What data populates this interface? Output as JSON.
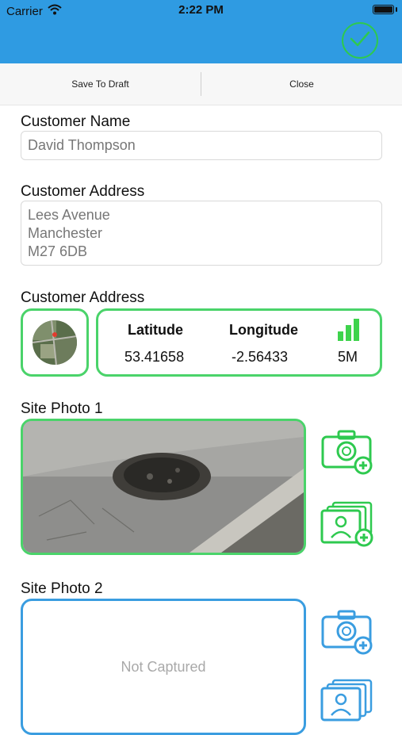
{
  "status_bar": {
    "carrier": "Carrier",
    "time": "2:22 PM"
  },
  "toolbar": {
    "save_draft_label": "Save To Draft",
    "close_label": "Close"
  },
  "customer_name": {
    "label": "Customer Name",
    "value": "David Thompson"
  },
  "customer_address": {
    "label": "Customer Address",
    "lines": [
      "Lees Avenue",
      "Manchester",
      "M27 6DB"
    ]
  },
  "location": {
    "label": "Customer Address",
    "latitude_label": "Latitude",
    "latitude_value": "53.41658",
    "longitude_label": "Longitude",
    "longitude_value": "-2.56433",
    "accuracy_value": "5M",
    "signal_bars": 3
  },
  "site_photo_1": {
    "label": "Site Photo 1",
    "status": "captured"
  },
  "site_photo_2": {
    "label": "Site Photo 2",
    "placeholder": "Not Captured"
  },
  "colors": {
    "header": "#2f9be2",
    "green": "#2ec94f",
    "blue": "#3a9de0"
  },
  "icons": [
    "wifi-icon",
    "battery-icon",
    "checkmark-icon",
    "map-icon",
    "signal-bars-icon",
    "camera-add-icon",
    "gallery-add-icon"
  ]
}
